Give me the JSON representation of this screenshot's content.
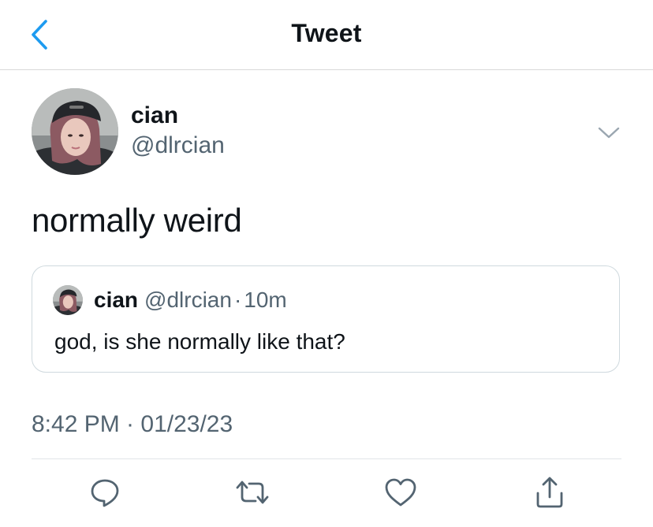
{
  "header": {
    "title": "Tweet",
    "back_icon": "chevron-left-icon"
  },
  "colors": {
    "accent": "#1d9bf0",
    "text": "#0f1419",
    "secondary_text": "#536471",
    "divider": "#cfd9de"
  },
  "tweet": {
    "author": {
      "name": "cian",
      "handle": "@dlrcian"
    },
    "menu_icon": "chevron-down-icon",
    "text": "normally weird",
    "quoted": {
      "name": "cian",
      "handle": "@dlrcian",
      "separator": "·",
      "time": "10m",
      "text": "god, is she normally like that?"
    },
    "timestamp": "8:42 PM · 01/23/23"
  },
  "actions": [
    {
      "icon": "reply-icon"
    },
    {
      "icon": "retweet-icon"
    },
    {
      "icon": "like-icon"
    },
    {
      "icon": "share-icon"
    }
  ]
}
